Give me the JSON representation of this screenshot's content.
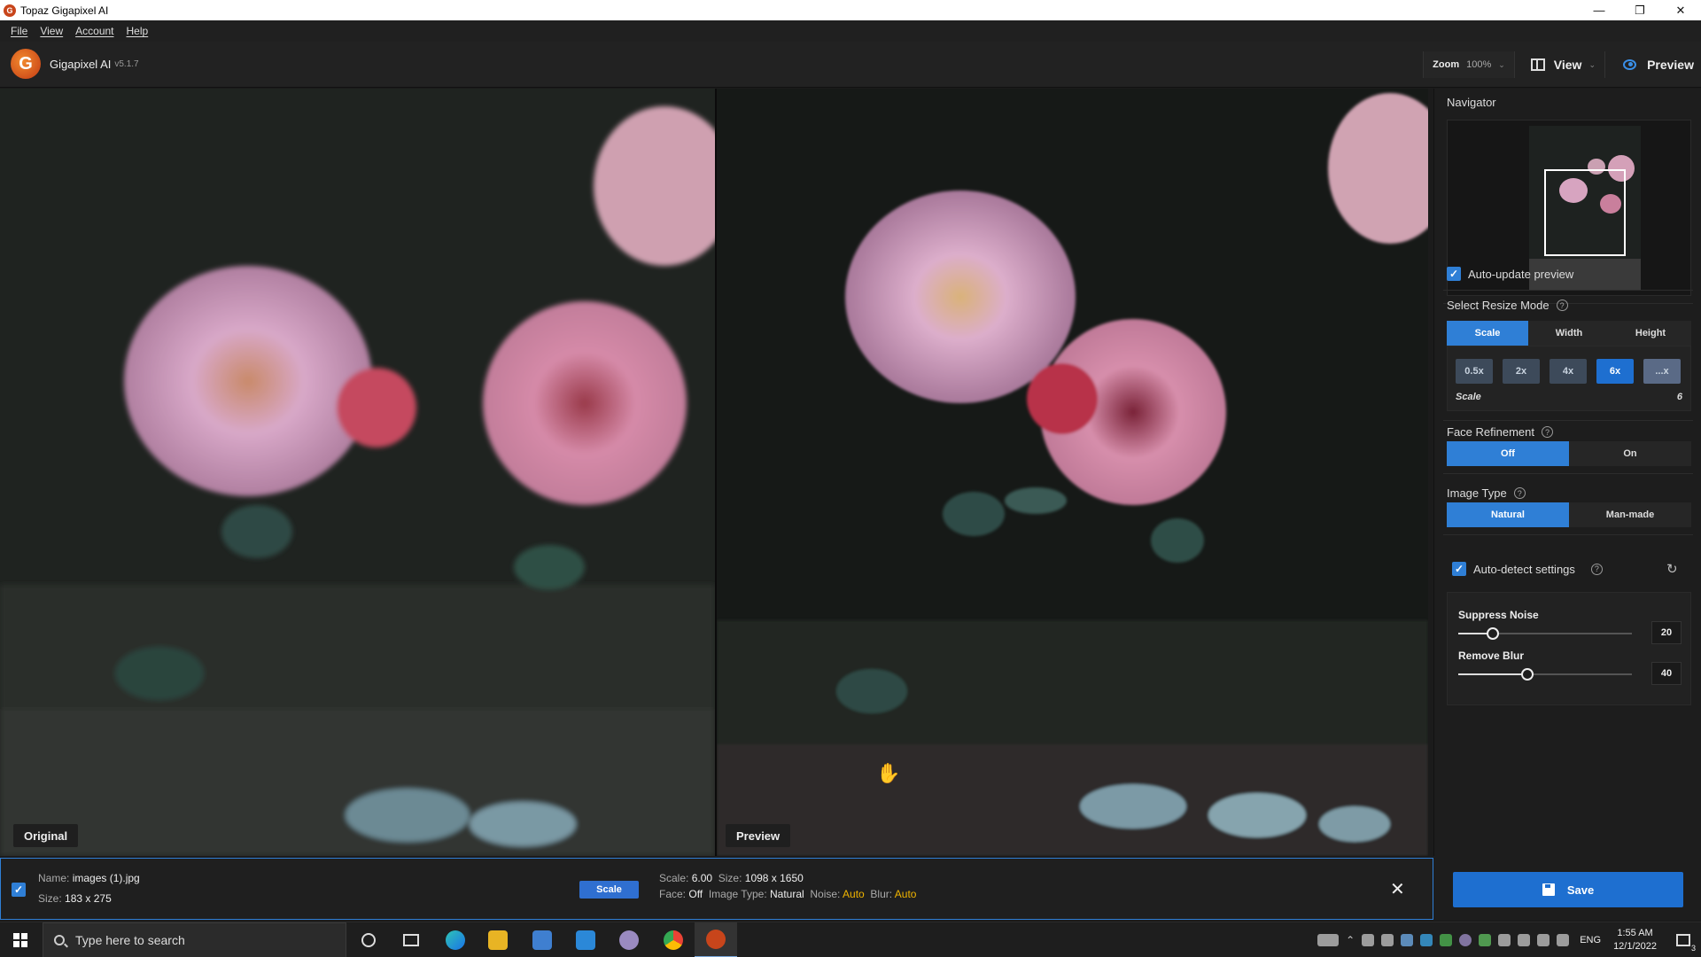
{
  "window": {
    "title": "Topaz Gigapixel AI",
    "logo_letter": "G",
    "controls": [
      "—",
      "❐",
      "✕"
    ]
  },
  "menu": [
    "File",
    "View",
    "Account",
    "Help"
  ],
  "header": {
    "app_name": "Gigapixel AI",
    "version": "v5.1.7",
    "zoom_label": "Zoom",
    "zoom_value": "100%",
    "view_label": "View",
    "preview_label": "Preview"
  },
  "panes": {
    "left_label": "Original",
    "right_label": "Preview"
  },
  "right_panel": {
    "navigator_title": "Navigator",
    "auto_update_label": "Auto-update preview",
    "resize_mode_title": "Select Resize Mode",
    "resize_modes": [
      "Scale",
      "Width",
      "Height"
    ],
    "resize_mode_active": "Scale",
    "scale_options": [
      "0.5x",
      "2x",
      "4x",
      "6x",
      "...x"
    ],
    "scale_active": "6x",
    "scale_label": "Scale",
    "scale_value": "6",
    "face_refinement_title": "Face Refinement",
    "face_options": [
      "Off",
      "On"
    ],
    "face_active": "Off",
    "image_type_title": "Image Type",
    "image_type_options": [
      "Natural",
      "Man-made"
    ],
    "image_type_active": "Natural",
    "auto_detect_label": "Auto-detect settings",
    "suppress_noise_label": "Suppress Noise",
    "suppress_noise_value": "20",
    "suppress_noise_level": 0.2,
    "remove_blur_label": "Remove Blur",
    "remove_blur_value": "40",
    "remove_blur_level": 0.4,
    "save_label": "Save"
  },
  "file_bar": {
    "name_label": "Name:",
    "name_value": "images (1).jpg",
    "size_label": "Size:",
    "size_value": "183 x 275",
    "scale_button": "Scale",
    "out_scale_label": "Scale:",
    "out_scale_value": "6.00",
    "out_size_label": "Size:",
    "out_size_value": "1098 x 1650",
    "face_label": "Face:",
    "face_value": "Off",
    "image_type_label": "Image Type:",
    "image_type_value": "Natural",
    "noise_label": "Noise:",
    "noise_value": "Auto",
    "blur_label": "Blur:",
    "blur_value": "Auto"
  },
  "taskbar": {
    "search_placeholder": "Type here to search",
    "language": "ENG",
    "time": "1:55 AM",
    "date": "12/1/2022",
    "notification_count": "3"
  },
  "colors": {
    "accent": "#2f7fd6",
    "highlight": "#f0b400"
  }
}
